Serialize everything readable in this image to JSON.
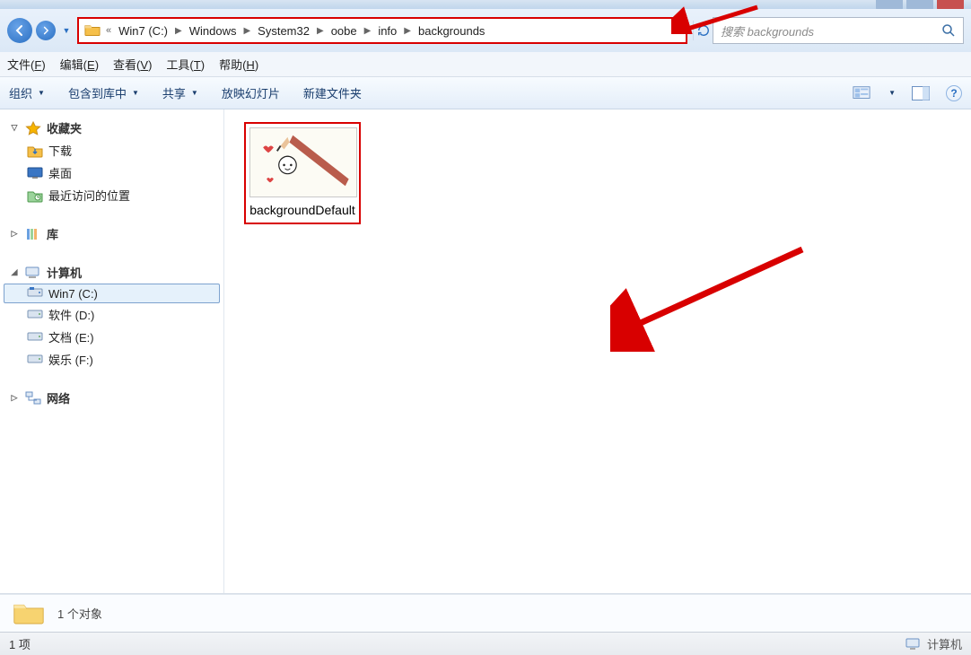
{
  "breadcrumb": {
    "root": "Win7 (C:)",
    "parts": [
      "Windows",
      "System32",
      "oobe",
      "info",
      "backgrounds"
    ]
  },
  "search": {
    "placeholder": "搜索 backgrounds"
  },
  "menubar": {
    "file": {
      "label": "文件",
      "accel": "F"
    },
    "edit": {
      "label": "编辑",
      "accel": "E"
    },
    "view": {
      "label": "查看",
      "accel": "V"
    },
    "tools": {
      "label": "工具",
      "accel": "T"
    },
    "help": {
      "label": "帮助",
      "accel": "H"
    }
  },
  "toolbar": {
    "organize": "组织",
    "include": "包含到库中",
    "share": "共享",
    "slideshow": "放映幻灯片",
    "newfolder": "新建文件夹"
  },
  "sidebar": {
    "favorites": {
      "header": "收藏夹",
      "downloads": "下载",
      "desktop": "桌面",
      "recent": "最近访问的位置"
    },
    "libraries": {
      "header": "库"
    },
    "computer": {
      "header": "计算机",
      "drives": [
        {
          "label": "Win7 (C:)",
          "selected": true
        },
        {
          "label": "软件 (D:)"
        },
        {
          "label": "文档 (E:)"
        },
        {
          "label": "娱乐 (F:)"
        }
      ]
    },
    "network": {
      "header": "网络"
    }
  },
  "file": {
    "name": "backgroundDefault"
  },
  "details": {
    "count_label": "1 个对象"
  },
  "statusbar": {
    "items": "1 项",
    "computer": "计算机"
  }
}
